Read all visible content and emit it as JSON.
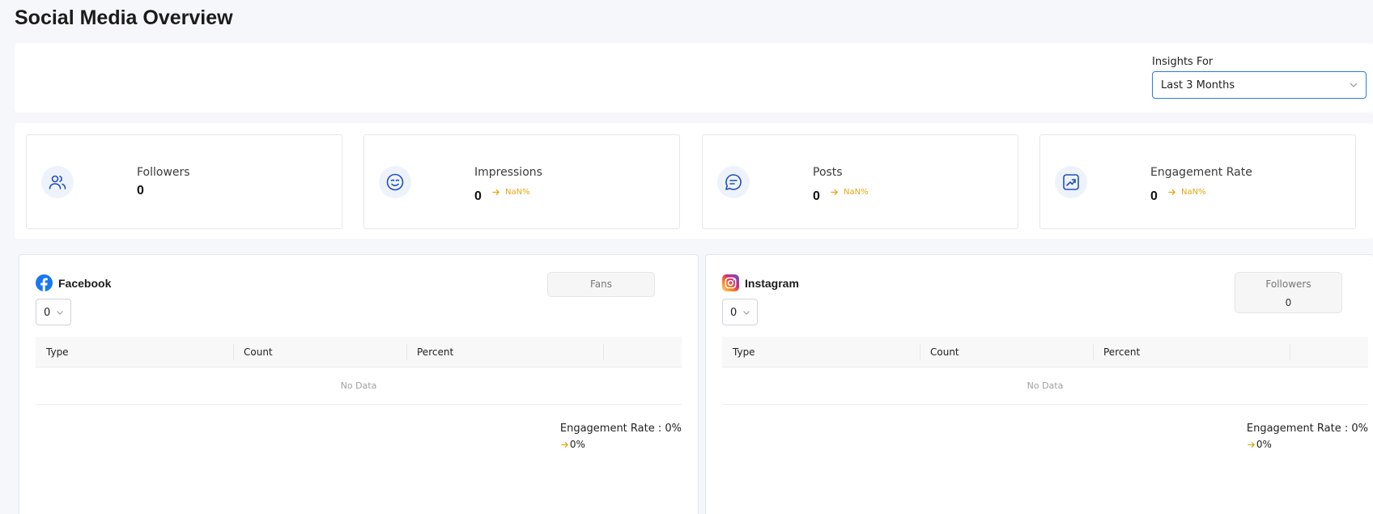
{
  "page": {
    "title": "Social Media Overview"
  },
  "filter": {
    "label": "Insights For",
    "value": "Last 3 Months"
  },
  "colors": {
    "accent": "#2a7de1",
    "icon": "#1f4fbf",
    "change": "#e6a617"
  },
  "stats": [
    {
      "label": "Followers",
      "value": "0",
      "icon": "users-icon"
    },
    {
      "label": "Impressions",
      "value": "0",
      "change": "NaN%",
      "icon": "smile-face-icon"
    },
    {
      "label": "Posts",
      "value": "0",
      "change": "NaN%",
      "icon": "chat-bubble-icon"
    },
    {
      "label": "Engagement Rate",
      "value": "0",
      "change": "NaN%",
      "icon": "trend-up-icon"
    }
  ],
  "facebook": {
    "name": "Facebook",
    "page_select": "0",
    "metric_label": "Fans",
    "columns": [
      "Type",
      "Count",
      "Percent"
    ],
    "empty_text": "No Data",
    "engagement_label": "Engagement Rate : 0%",
    "engagement_change": "0%"
  },
  "instagram": {
    "name": "Instagram",
    "page_select": "0",
    "metric_label": "Followers",
    "metric_value": "0",
    "columns": [
      "Type",
      "Count",
      "Percent"
    ],
    "empty_text": "No Data",
    "engagement_label": "Engagement Rate : 0%",
    "engagement_change": "0%"
  }
}
